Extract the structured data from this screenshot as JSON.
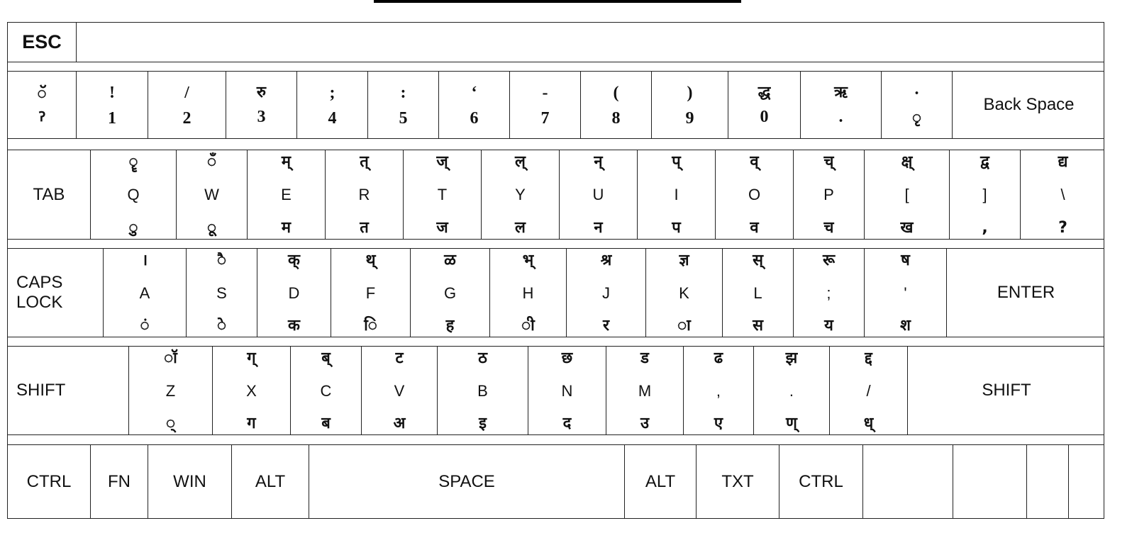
{
  "keyboard": {
    "row_fn": {
      "keys": [
        {
          "label": "ESC"
        },
        {
          "label": ""
        }
      ]
    },
    "row_num": {
      "keys": [
        {
          "top": "ॅ",
          "bottom": "ॽ"
        },
        {
          "top": "!",
          "bottom": "1"
        },
        {
          "top": "/",
          "bottom": "2"
        },
        {
          "top": "रु",
          "bottom": "3"
        },
        {
          "top": ";",
          "bottom": "4"
        },
        {
          "top": ":",
          "bottom": "5"
        },
        {
          "top": "‘",
          "bottom": "6"
        },
        {
          "top": "-",
          "bottom": "7"
        },
        {
          "top": "(",
          "bottom": "8"
        },
        {
          "top": ")",
          "bottom": "9"
        },
        {
          "top": "द्ध",
          "bottom": "0"
        },
        {
          "top": "ऋ",
          "bottom": "."
        },
        {
          "top": "·",
          "bottom": "ृ"
        },
        {
          "label": "Back Space"
        }
      ]
    },
    "row_top": {
      "keys": [
        {
          "label": "TAB"
        },
        {
          "top": "ॄ",
          "mid": "Q",
          "bottom": "ु"
        },
        {
          "top": "ँ",
          "mid": "W",
          "bottom": "ू"
        },
        {
          "top": "म्",
          "mid": "E",
          "bottom": "म"
        },
        {
          "top": "त्",
          "mid": "R",
          "bottom": "त"
        },
        {
          "top": "ज्",
          "mid": "T",
          "bottom": "ज"
        },
        {
          "top": "ल्",
          "mid": "Y",
          "bottom": "ल"
        },
        {
          "top": "न्",
          "mid": "U",
          "bottom": "न"
        },
        {
          "top": "प्",
          "mid": "I",
          "bottom": "प"
        },
        {
          "top": "व्",
          "mid": "O",
          "bottom": "व"
        },
        {
          "top": "च्",
          "mid": "P",
          "bottom": "च"
        },
        {
          "top": "क्ष्",
          "mid": "[",
          "bottom": "ख"
        },
        {
          "top": "द्व",
          "mid": "]",
          "bottom": ","
        },
        {
          "top": "द्य",
          "mid": "\\",
          "bottom": "?"
        }
      ]
    },
    "row_home": {
      "keys": [
        {
          "label": "CAPS\nLOCK"
        },
        {
          "top": "।",
          "mid": "A",
          "bottom": "ं"
        },
        {
          "top": "ै",
          "mid": "S",
          "bottom": "े"
        },
        {
          "top": "क्",
          "mid": "D",
          "bottom": "क"
        },
        {
          "top": "थ्",
          "mid": "F",
          "bottom": "ि"
        },
        {
          "top": "ळ",
          "mid": "G",
          "bottom": "ह"
        },
        {
          "top": "भ्",
          "mid": "H",
          "bottom": "ी"
        },
        {
          "top": "श्र",
          "mid": "J",
          "bottom": "र"
        },
        {
          "top": "ज्ञ",
          "mid": "K",
          "bottom": "ा"
        },
        {
          "top": "स्",
          "mid": "L",
          "bottom": "स"
        },
        {
          "top": "रू",
          "mid": ";",
          "bottom": "य"
        },
        {
          "top": "ष",
          "mid": "'",
          "bottom": "श"
        },
        {
          "label": "ENTER"
        }
      ]
    },
    "row_bottom": {
      "keys": [
        {
          "label": "SHIFT"
        },
        {
          "top": "ॉ",
          "mid": "Z",
          "bottom": "्"
        },
        {
          "top": "ग्",
          "mid": "X",
          "bottom": "ग"
        },
        {
          "top": "ब्",
          "mid": "C",
          "bottom": "ब"
        },
        {
          "top": "ट",
          "mid": "V",
          "bottom": "अ"
        },
        {
          "top": "ठ",
          "mid": "B",
          "bottom": "इ"
        },
        {
          "top": "छ",
          "mid": "N",
          "bottom": "द"
        },
        {
          "top": "ड",
          "mid": "M",
          "bottom": "उ"
        },
        {
          "top": "ढ",
          "mid": ",",
          "bottom": "ए"
        },
        {
          "top": "झ",
          "mid": ".",
          "bottom": "ण्"
        },
        {
          "top": "द्द",
          "mid": "/",
          "bottom": "ध्"
        },
        {
          "label": "SHIFT"
        }
      ]
    },
    "row_space": {
      "keys": [
        {
          "label": "CTRL"
        },
        {
          "label": "FN"
        },
        {
          "label": "WIN"
        },
        {
          "label": "ALT"
        },
        {
          "label": "SPACE"
        },
        {
          "label": "ALT"
        },
        {
          "label": "TXT"
        },
        {
          "label": "CTRL"
        },
        {
          "label": ""
        },
        {
          "label": ""
        },
        {
          "label": ""
        },
        {
          "label": ""
        }
      ]
    }
  }
}
